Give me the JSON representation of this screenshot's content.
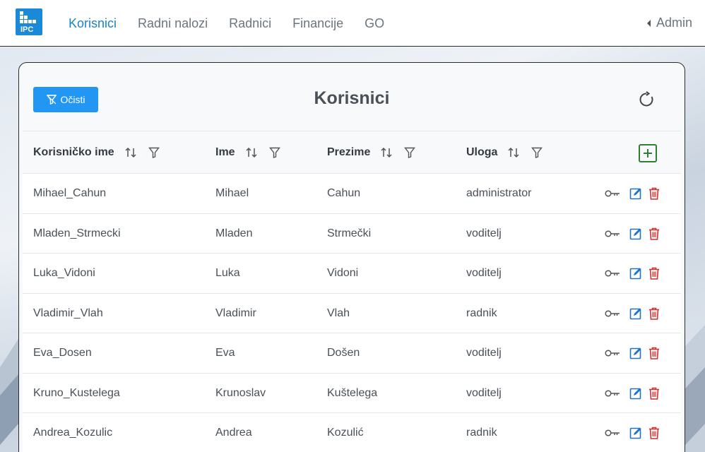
{
  "navbar": {
    "logo_text": "IPC",
    "items": [
      {
        "label": "Korisnici",
        "active": true
      },
      {
        "label": "Radni nalozi",
        "active": false
      },
      {
        "label": "Radnici",
        "active": false
      },
      {
        "label": "Financije",
        "active": false
      },
      {
        "label": "GO",
        "active": false
      }
    ],
    "user_label": "Admin"
  },
  "card": {
    "clear_button_label": "Očisti",
    "title": "Korisnici",
    "refresh_icon": "refresh-icon"
  },
  "table": {
    "columns": [
      {
        "label": "Korisničko ime",
        "sortable": true,
        "filterable": true
      },
      {
        "label": "Ime",
        "sortable": true,
        "filterable": true
      },
      {
        "label": "Prezime",
        "sortable": true,
        "filterable": true
      },
      {
        "label": "Uloga",
        "sortable": true,
        "filterable": true
      }
    ],
    "rows": [
      {
        "username": "Mihael_Cahun",
        "first_name": "Mihael",
        "last_name": "Cahun",
        "role": "administrator"
      },
      {
        "username": "Mladen_Strmecki",
        "first_name": "Mladen",
        "last_name": "Strmečki",
        "role": "voditelj"
      },
      {
        "username": "Luka_Vidoni",
        "first_name": "Luka",
        "last_name": "Vidoni",
        "role": "voditelj"
      },
      {
        "username": "Vladimir_Vlah",
        "first_name": "Vladimir",
        "last_name": "Vlah",
        "role": "radnik"
      },
      {
        "username": "Eva_Dosen",
        "first_name": "Eva",
        "last_name": "Došen",
        "role": "voditelj"
      },
      {
        "username": "Kruno_Kustelega",
        "first_name": "Krunoslav",
        "last_name": "Kuštelega",
        "role": "voditelj"
      },
      {
        "username": "Andrea_Kozulic",
        "first_name": "Andrea",
        "last_name": "Kozulić",
        "role": "radnik"
      }
    ],
    "row_actions": [
      "key-icon",
      "edit-icon",
      "trash-icon"
    ]
  },
  "colors": {
    "accent": "#1c82c8",
    "button": "#2196f3",
    "edit": "#1e73c8",
    "delete": "#d32f2f",
    "add": "#2e7d32"
  }
}
